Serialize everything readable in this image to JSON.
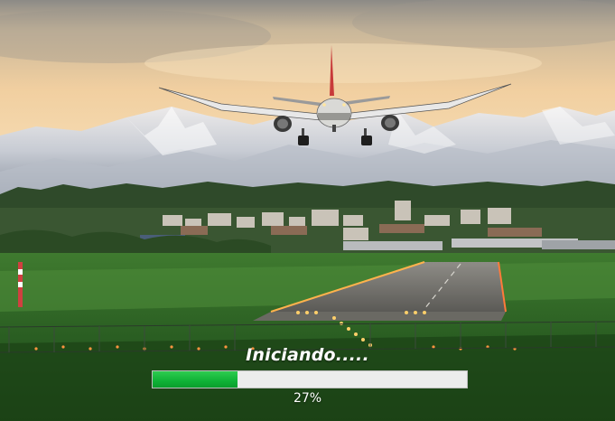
{
  "splash": {
    "status_text": "Iniciando.....",
    "progress": 0.27,
    "percent_text": "27%"
  },
  "colors": {
    "progress_fill": "#12b83a",
    "progress_track": "#ececec",
    "text": "#ffffff"
  }
}
